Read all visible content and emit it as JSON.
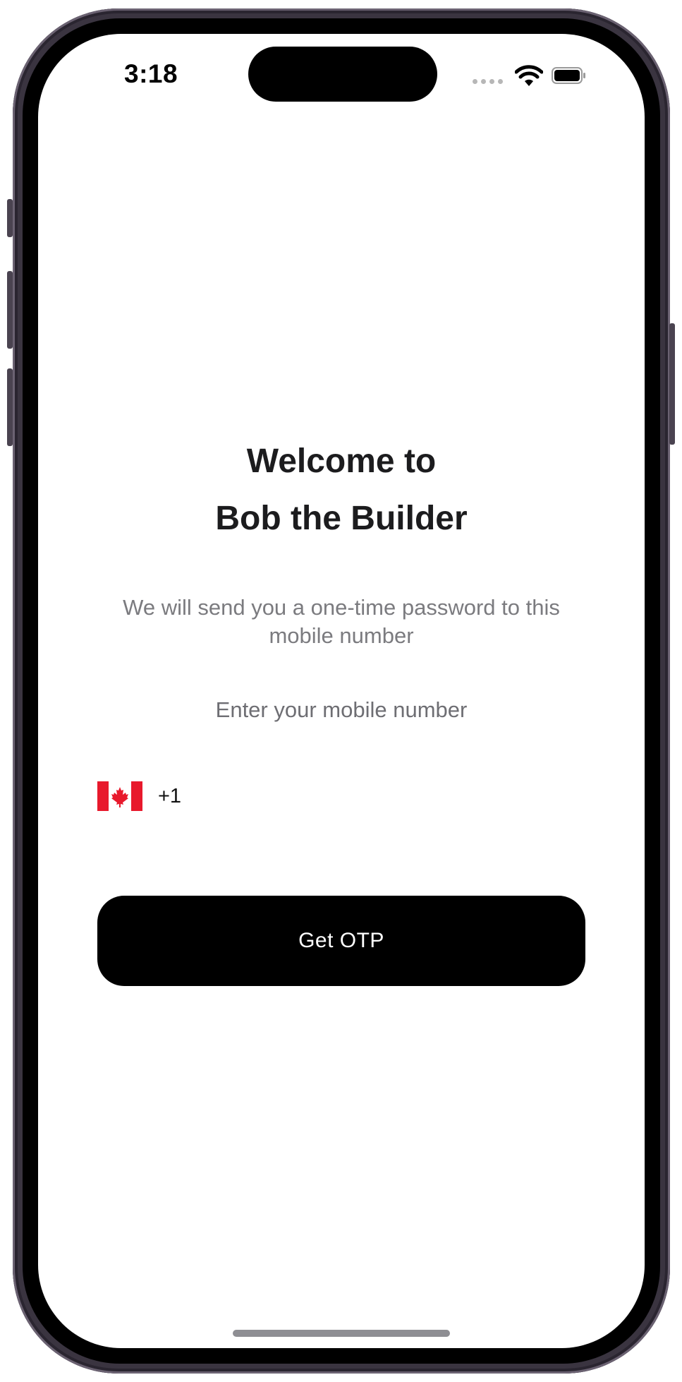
{
  "status_bar": {
    "time": "3:18",
    "icons": [
      "cellular-signal-icon",
      "wifi-icon",
      "battery-icon"
    ]
  },
  "welcome": {
    "title_line_1": "Welcome to",
    "title_line_2": "Bob the Builder",
    "subtitle": "We will send you a one-time password to this mobile number"
  },
  "phone": {
    "label": "Enter your mobile number",
    "country_flag": "canada-flag-icon",
    "dial_code": "+1",
    "value": "",
    "placeholder": ""
  },
  "actions": {
    "get_otp_label": "Get OTP"
  },
  "colors": {
    "button_background": "#000000",
    "button_text": "#ffffff",
    "title_text": "#1c1c1e",
    "secondary_text": "#7b7b7f",
    "flag_red": "#e8192c"
  }
}
